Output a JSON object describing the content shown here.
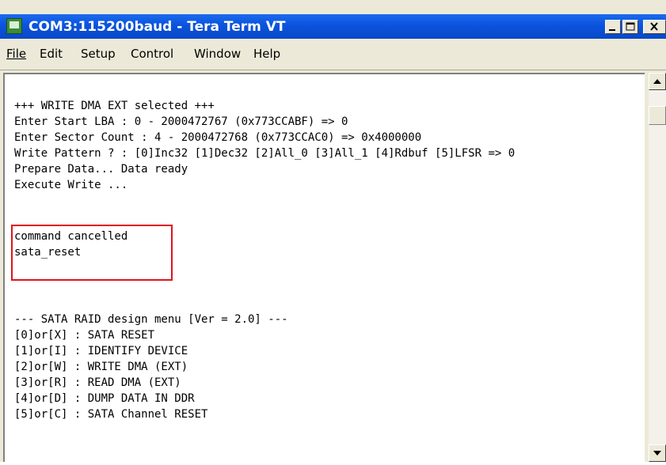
{
  "window": {
    "title": "COM3:115200baud - Tera Term VT"
  },
  "menu": [
    "File",
    "Edit",
    "Setup",
    "Control",
    "Window",
    "Help"
  ],
  "terminal_lines": [
    "+++ WRITE DMA EXT selected +++",
    "Enter Start LBA : 0 - 2000472767 (0x773CCABF) => 0",
    "Enter Sector Count : 4 - 2000472768 (0x773CCAC0) => 0x4000000",
    "Write Pattern ? : [0]Inc32 [1]Dec32 [2]All_0 [3]All_1 [4]Rdbuf [5]LFSR => 0",
    "Prepare Data... Data ready",
    "Execute Write ...",
    "",
    "command cancelled",
    "sata_reset",
    "",
    "",
    "--- SATA RAID design menu [Ver = 2.0] ---",
    "[0]or[X] : SATA RESET",
    "[1]or[I] : IDENTIFY DEVICE",
    "[2]or[W] : WRITE DMA (EXT)",
    "[3]or[R] : READ DMA (EXT)",
    "[4]or[D] : DUMP DATA IN DDR",
    "[5]or[C] : SATA Channel RESET"
  ],
  "icons": {
    "app": "teraterm-app-icon",
    "minimize": "minimize-icon",
    "maximize": "maximize-icon",
    "close": "close-icon",
    "scroll_up": "scroll-up-arrow-icon",
    "scroll_down": "scroll-down-arrow-icon"
  },
  "colors": {
    "titlebar": "#0b53dd",
    "highlight_box": "#e0141c"
  }
}
